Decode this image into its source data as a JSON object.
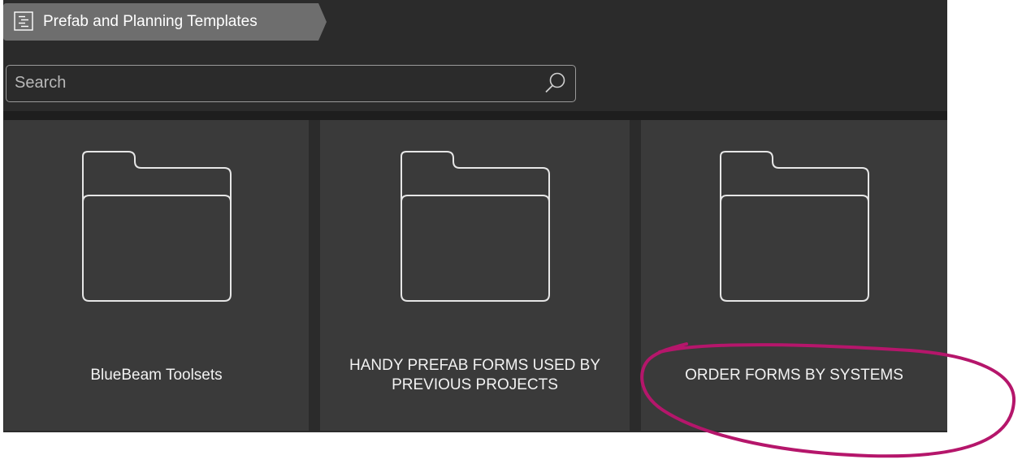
{
  "breadcrumb": {
    "icon": "template-list-icon",
    "label": "Prefab and Planning Templates"
  },
  "search": {
    "placeholder": "Search",
    "value": ""
  },
  "folders": [
    {
      "label": "BlueBeam Toolsets",
      "icon": "folder-icon"
    },
    {
      "label": "HANDY PREFAB FORMS USED BY PREVIOUS PROJECTS",
      "icon": "folder-icon"
    },
    {
      "label": "ORDER FORMS BY SYSTEMS",
      "icon": "folder-icon"
    }
  ],
  "colors": {
    "panel_bg": "#2b2b2b",
    "tile_bg": "#3a3a3a",
    "breadcrumb_bg": "#6e6e6e",
    "annotation": "#b5166b"
  }
}
